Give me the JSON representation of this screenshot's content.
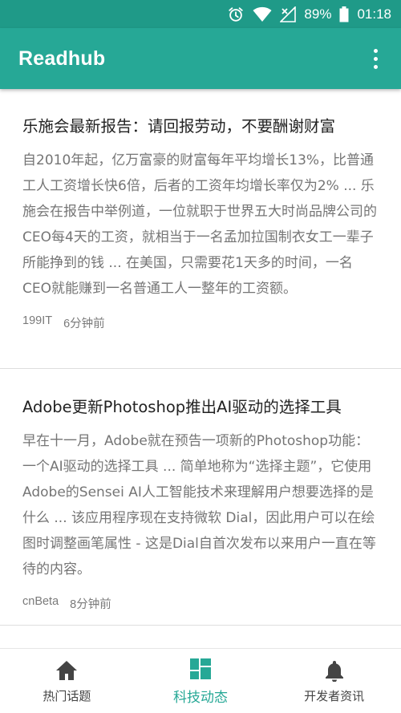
{
  "colors": {
    "status_bar": "#1f9a88",
    "app_bar": "#26a896",
    "accent": "#26a896",
    "title_text": "#222222",
    "summary_text": "#757575",
    "nav_inactive": "#444444"
  },
  "status_bar": {
    "icons": [
      "alarm-icon",
      "wifi-icon",
      "signal-no-data-icon",
      "battery-icon"
    ],
    "battery": "89%",
    "time": "01:18"
  },
  "app_bar": {
    "title": "Readhub",
    "menu_icon": "more-vertical-icon"
  },
  "articles": [
    {
      "title": "乐施会最新报告：请回报劳动，不要酬谢财富",
      "summary": "自2010年起，亿万富豪的财富每年平均增长13%，比普通工人工资增长快6倍，后者的工资年均增长率仅为2% ... 乐施会在报告中举例道，一位就职于世界五大时尚品牌公司的CEO每4天的工资，就相当于一名孟加拉国制衣女工一辈子所能挣到的钱 ... 在美国，只需要花1天多的时间，一名CEO就能赚到一名普通工人一整年的工资额。",
      "source": "199IT",
      "time": "6分钟前"
    },
    {
      "title": "Adobe更新Photoshop推出AI驱动的选择工具",
      "summary": "早在十一月，Adobe就在预告一项新的Photoshop功能：一个AI驱动的选择工具 ... 简单地称为“选择主题”，它使用Adobe的Sensei AI人工智能技术来理解用户想要选择的是什么 ... 该应用程序现在支持微软 Dial，因此用户可以在绘图时调整画笔属性 - 这是Dial自首次发布以来用户一直在等待的内容。",
      "source": "cnBeta",
      "time": "8分钟前"
    }
  ],
  "bottom_nav": [
    {
      "label": "热门话题",
      "icon": "home-icon",
      "active": false
    },
    {
      "label": "科技动态",
      "icon": "dashboard-icon",
      "active": true
    },
    {
      "label": "开发者资讯",
      "icon": "bell-icon",
      "active": false
    }
  ]
}
